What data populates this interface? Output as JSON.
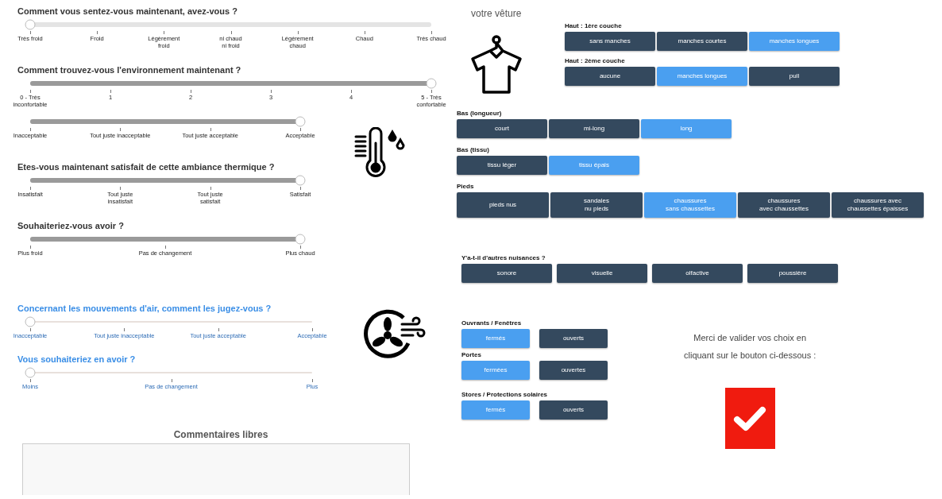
{
  "thermal": [
    {
      "title": "Comment vous sentez-vous maintenant, avez-vous ?",
      "sliders": [
        {
          "kind": "wide",
          "level": 0,
          "labels": [
            "Très froid",
            "Froid",
            "Légèrement\nfroid",
            "ni chaud\nni froid",
            "Légèrement\nchaud",
            "Chaud",
            "Très chaud"
          ]
        }
      ]
    },
    {
      "title": "Comment trouvez-vous l'environnement maintenant ?",
      "sliders": [
        {
          "kind": "wide",
          "level": 1,
          "labels": [
            "0 - Très\ninconfortable",
            "1",
            "2",
            "3",
            "4",
            "5 - Très\nconfortable"
          ]
        },
        {
          "kind": "narrow",
          "level": 1,
          "labels": [
            "Inacceptable",
            "Tout juste inacceptable",
            "Tout juste acceptable",
            "Acceptable"
          ]
        }
      ]
    },
    {
      "title": "Etes-vous maintenant satisfait de cette ambiance thermique ?",
      "sliders": [
        {
          "kind": "narrow",
          "level": 1,
          "labels": [
            "Insatisfait",
            "Tout juste\ninsatisfait",
            "Tout juste\nsatisfait",
            "Satisfait"
          ]
        }
      ]
    },
    {
      "title": "Souhaiteriez-vous avoir ?",
      "sliders": [
        {
          "kind": "narrow",
          "level": 1,
          "labels": [
            "Plus froid",
            "Pas de changement",
            "Plus chaud"
          ]
        }
      ]
    }
  ],
  "air": [
    {
      "title": "Concernant les mouvements d'air, comment les jugez-vous ?",
      "level": 0,
      "labels": [
        "Inacceptable",
        "Tout juste inacceptable",
        "Tout juste acceptable",
        "Acceptable"
      ]
    },
    {
      "title": "Vous souhaiteriez en avoir ?",
      "level": 0,
      "labels": [
        "Moins",
        "Pas de changement",
        "Plus"
      ]
    }
  ],
  "comments": {
    "title": "Commentaires libres"
  },
  "clothing": {
    "title": "votre vêture",
    "groups": [
      {
        "label": "Haut : 1ère couche",
        "options": [
          {
            "label": "sans manches",
            "selected": false
          },
          {
            "label": "manches courtes",
            "selected": false
          },
          {
            "label": "manches longues",
            "selected": true
          }
        ]
      },
      {
        "label": "Haut : 2ème couche",
        "options": [
          {
            "label": "aucune",
            "selected": false
          },
          {
            "label": "manches longues",
            "selected": true
          },
          {
            "label": "pull",
            "selected": false
          }
        ]
      },
      {
        "label": "Bas (longueur)",
        "options": [
          {
            "label": "court",
            "selected": false
          },
          {
            "label": "mi-long",
            "selected": false
          },
          {
            "label": "long",
            "selected": true
          }
        ]
      },
      {
        "label": "Bas (tissu)",
        "options": [
          {
            "label": "tissu léger",
            "selected": false
          },
          {
            "label": "tissu épais",
            "selected": true
          }
        ]
      },
      {
        "label": "Pieds",
        "options": [
          {
            "label": "pieds nus",
            "selected": false
          },
          {
            "label": "sandales\nnu pieds",
            "selected": false
          },
          {
            "label": "chaussures\nsans chaussettes",
            "selected": true
          },
          {
            "label": "chaussures\navec chaussettes",
            "selected": false
          },
          {
            "label": "chaussures avec\nchaussettes épaisses",
            "selected": false
          }
        ]
      }
    ]
  },
  "nuisances": {
    "title": "Y'a-t-il d'autres nuisances ?",
    "options": [
      {
        "label": "sonore",
        "selected": false
      },
      {
        "label": "visuelle",
        "selected": false
      },
      {
        "label": "olfactive",
        "selected": false
      },
      {
        "label": "poussière",
        "selected": false
      }
    ]
  },
  "openings": [
    {
      "label": "Ouvrants / Fenêtres",
      "options": [
        {
          "label": "fermés",
          "selected": true
        },
        {
          "label": "ouverts",
          "selected": false
        }
      ]
    },
    {
      "label": "Portes",
      "options": [
        {
          "label": "fermées",
          "selected": true
        },
        {
          "label": "ouvertes",
          "selected": false
        }
      ]
    },
    {
      "label": "Stores / Protections solaires",
      "options": [
        {
          "label": "fermés",
          "selected": true
        },
        {
          "label": "ouverts",
          "selected": false
        }
      ]
    }
  ],
  "validation": {
    "message": "Merci de valider vos choix en\ncliquant sur le bouton ci-dessous :"
  }
}
